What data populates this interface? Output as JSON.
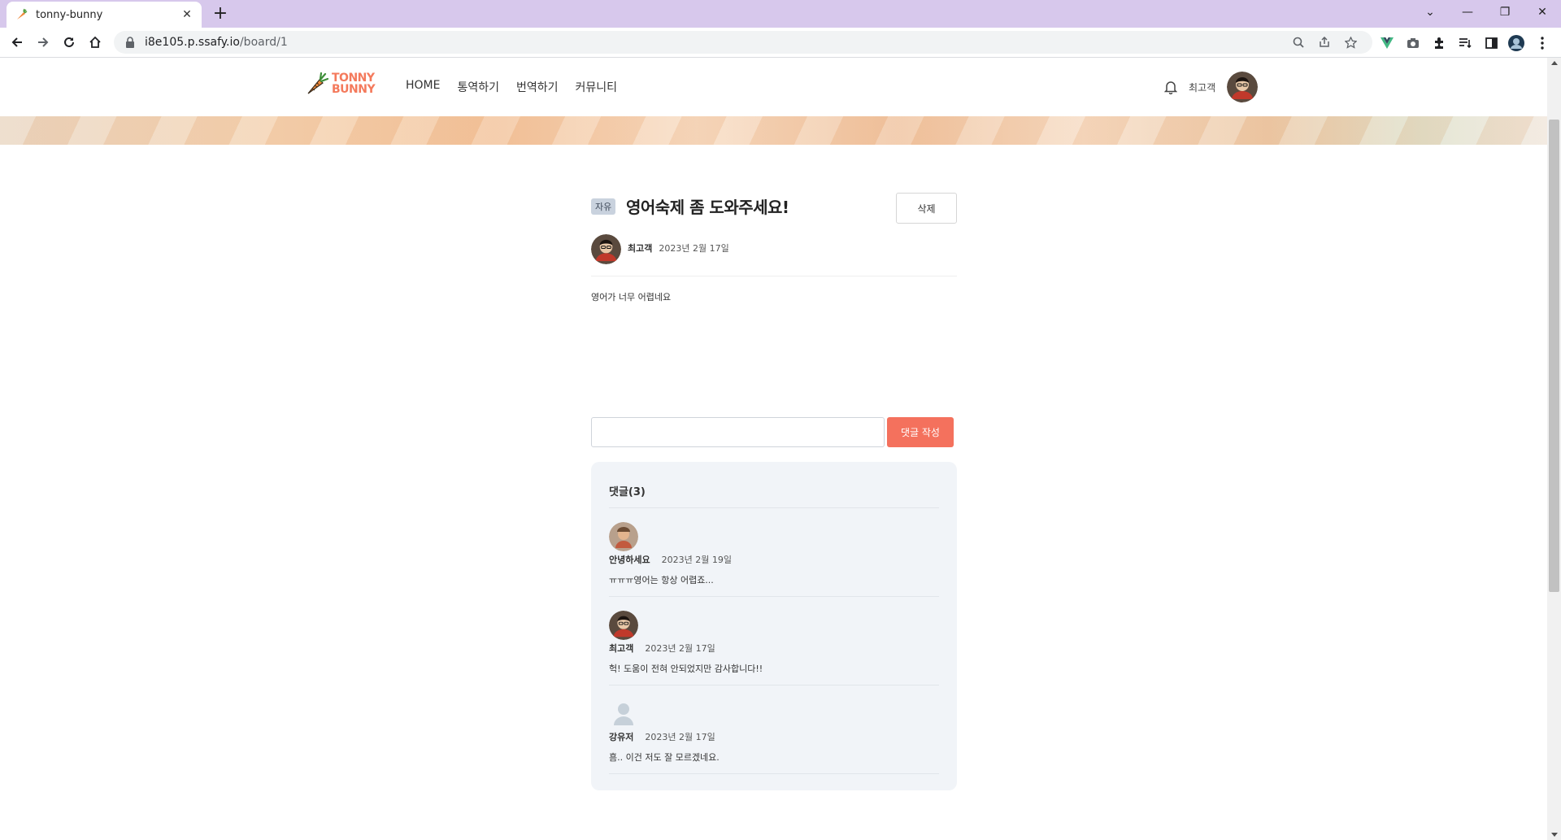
{
  "browser": {
    "tab_title": "tonny-bunny",
    "tab_close": "✕",
    "new_tab": "+",
    "url_host": "i8e105.p.ssafy.io",
    "url_path": "/board/1",
    "window_controls": [
      "⌄",
      "—",
      "❐",
      "✕"
    ]
  },
  "site": {
    "logo": {
      "line1": "TONNY",
      "line2": "BUNNY"
    },
    "nav": [
      "HOME",
      "통역하기",
      "번역하기",
      "커뮤니티"
    ],
    "header_user": "최고객"
  },
  "post": {
    "category": "자유",
    "title": "영어숙제 좀 도와주세요!",
    "delete_label": "삭제",
    "author": "최고객",
    "date": "2023년 2월 17일",
    "body": "영어가 너무 어렵네요"
  },
  "comment_form": {
    "placeholder": "",
    "submit_label": "댓글 작성"
  },
  "comments": {
    "title": "댓글(3)",
    "items": [
      {
        "author": "안녕하세요",
        "date": "2023년 2월 19일",
        "text": "ㅠㅠㅠ영어는 항상 어렵죠..."
      },
      {
        "author": "최고객",
        "date": "2023년 2월 17일",
        "text": "헉! 도움이 전혀 안되었지만 감사합니다!!"
      },
      {
        "author": "강유저",
        "date": "2023년 2월 17일",
        "text": "흠.. 이건 저도 잘 모르겠네요."
      }
    ]
  },
  "colors": {
    "accent": "#f4715d",
    "logo": "#f47a5c",
    "tabbar": "#d7c8ec",
    "comments_bg": "#f1f4f8"
  }
}
